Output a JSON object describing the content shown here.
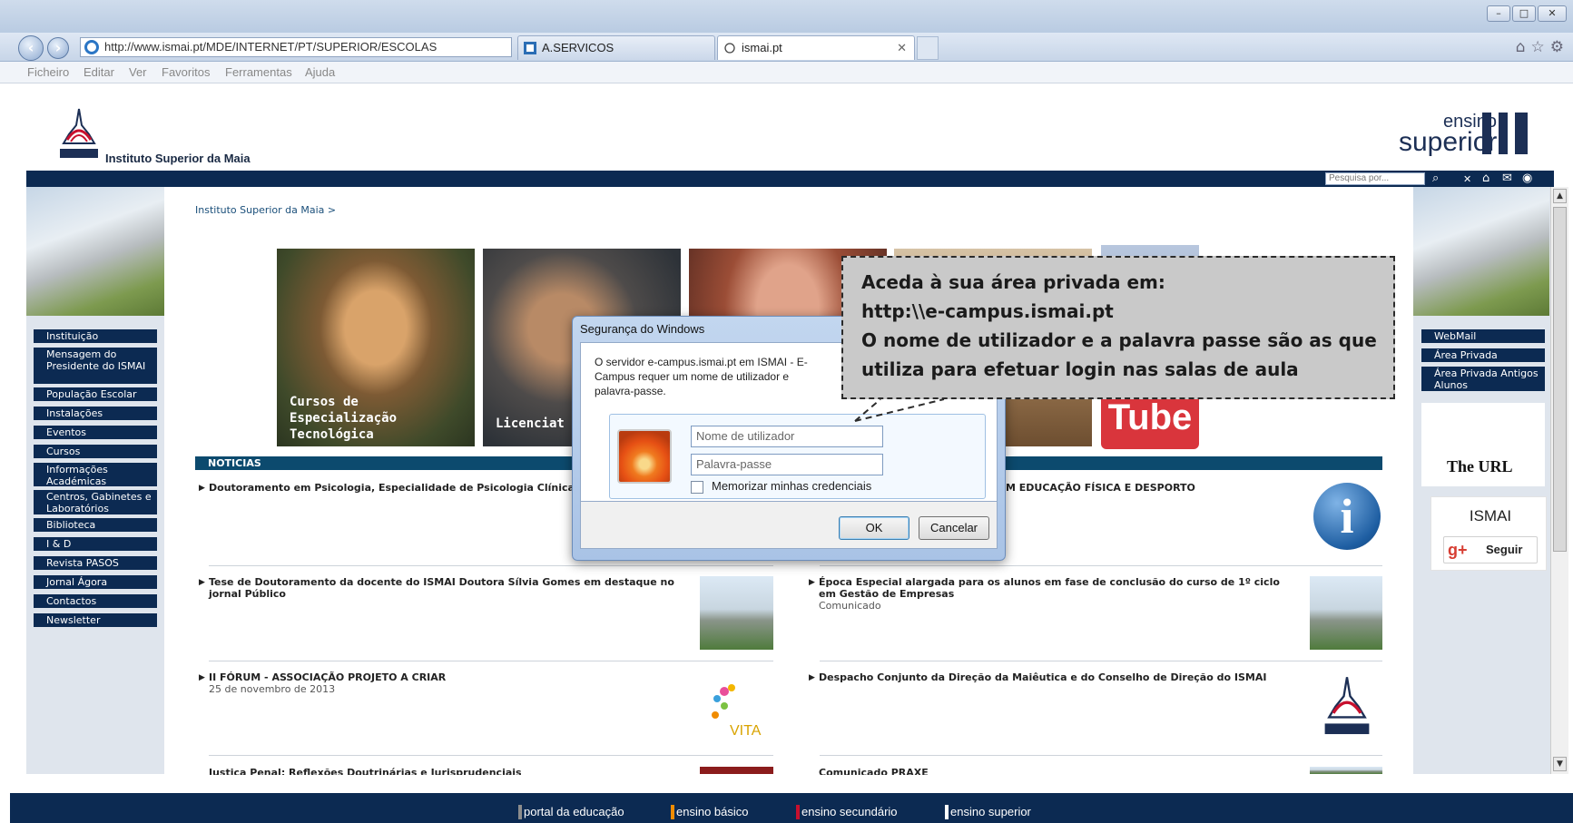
{
  "browser": {
    "url": "http://www.ismai.pt/MDE/INTERNET/PT/SUPERIOR/ESCOLAS",
    "tabs": [
      {
        "label": "A.SERVICOS"
      },
      {
        "label": "ismai.pt"
      }
    ],
    "menu": [
      "Ficheiro",
      "Editar",
      "Ver",
      "Favoritos",
      "Ferramentas",
      "Ajuda"
    ]
  },
  "header": {
    "logo_name": "Instituto Superior da Maia",
    "brand_top": "ensino",
    "brand_bottom": "superior",
    "search_placeholder": "Pesquisa por..."
  },
  "breadcrumb": "Instituto Superior da Maia  >",
  "left_nav": [
    "Instituição",
    "Mensagem do Presidente do ISMAI",
    "População Escolar",
    "Instalações",
    "Eventos",
    "Cursos",
    "Informações Académicas",
    "Centros, Gabinetes e Laboratórios",
    "Biblioteca",
    "I & D",
    "Revista PASOS",
    "Jornal Ágora",
    "Contactos",
    "Newsletter"
  ],
  "right_nav": [
    "WebMail",
    "Área Privada",
    "Área Privada Antigos Alunos"
  ],
  "right_widgets": {
    "url_text": "The URL",
    "gplus_title": "ISMAI",
    "gplus_follow": "Seguir"
  },
  "tiles": [
    {
      "caption_line1": "Cursos de",
      "caption_line2": "Especialização",
      "caption_line3": "Tecnológica"
    },
    {
      "caption_line1": "Licenciat"
    }
  ],
  "news": {
    "header": "NOTICIAS",
    "items": [
      {
        "title": "Doutoramento em Psicologia, Especialidade de Psicologia Clínica"
      },
      {
        "title": "M EDUCAÇÃO FÍSICA E DESPORTO"
      },
      {
        "title": "Tese de Doutoramento da docente do ISMAI Doutora Sílvia Gomes em destaque no jornal Público"
      },
      {
        "title": "Época Especial alargada para os alunos em fase de conclusão do curso de 1º ciclo em Gestão de Empresas",
        "subtitle": "Comunicado"
      },
      {
        "title": "II FÓRUM - ASSOCIAÇÃO PROJETO A CRIAR",
        "subtitle": "25 de novembro de 2013"
      },
      {
        "title": "Despacho Conjunto da Direção da Maiêutica e do Conselho de Direção do ISMAI"
      },
      {
        "title": "Justiça Penal: Reflexões Doutrinárias e Jurisprudenciais"
      },
      {
        "title": "Comunicado PRAXE"
      }
    ]
  },
  "footer_links": [
    {
      "label": "portal da educação",
      "color": "#8c8c8c"
    },
    {
      "label": "ensino básico",
      "color": "#f08c00"
    },
    {
      "label": "ensino secundário",
      "color": "#c8102e"
    },
    {
      "label": "ensino superior",
      "color": "#ffffff"
    }
  ],
  "dialog": {
    "title": "Segurança do Windows",
    "message": "O servidor e-campus.ismai.pt em ISMAI - E-Campus requer um nome de utilizador e palavra-passe.",
    "username_placeholder": "Nome de utilizador",
    "password_placeholder": "Palavra-passe",
    "remember_label": "Memorizar minhas credenciais",
    "ok_label": "OK",
    "cancel_label": "Cancelar"
  },
  "callout": {
    "line1": "Aceda à sua área privada em:",
    "line2": "http:\\\\e-campus.ismai.pt",
    "line3": "O nome de utilizador e a palavra passe são as que",
    "line4": "utiliza para efetuar login nas salas de aula"
  }
}
